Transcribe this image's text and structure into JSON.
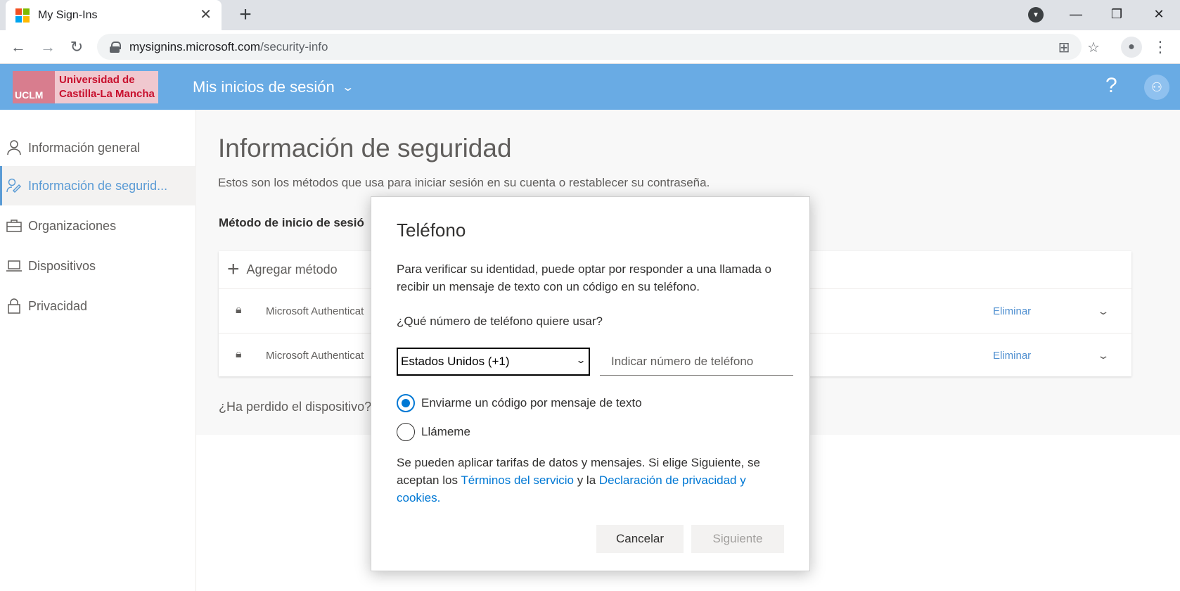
{
  "browser": {
    "tab_title": "My Sign-Ins",
    "url_host": "mysignins.microsoft.com",
    "url_path": "/security-info"
  },
  "header": {
    "org_badge": "UCLM",
    "org_name_line1": "Universidad de",
    "org_name_line2": "Castilla-La Mancha",
    "app_title": "Mis inicios de sesión",
    "help_label": "?"
  },
  "sidebar": {
    "items": [
      {
        "label": "Información general",
        "icon": "person-icon"
      },
      {
        "label": "Información de segurid...",
        "icon": "security-info-icon"
      },
      {
        "label": "Organizaciones",
        "icon": "briefcase-icon"
      },
      {
        "label": "Dispositivos",
        "icon": "laptop-icon"
      },
      {
        "label": "Privacidad",
        "icon": "lock-icon"
      }
    ]
  },
  "main": {
    "title": "Información de seguridad",
    "subtitle": "Estos son los métodos que usa para iniciar sesión en su cuenta o restablecer su contraseña.",
    "method_header": "Método de inicio de sesió",
    "add_method": "Agregar método",
    "methods": [
      {
        "name": "Microsoft Authenticat",
        "action": "Eliminar"
      },
      {
        "name": "Microsoft Authenticat",
        "action": "Eliminar"
      }
    ],
    "lost_device": "¿Ha perdido el dispositivo?"
  },
  "dialog": {
    "title": "Teléfono",
    "description": "Para verificar su identidad, puede optar por responder a una llamada o recibir un mensaje de texto con un código en su teléfono.",
    "question": "¿Qué número de teléfono quiere usar?",
    "country_value": "Estados Unidos (+1)",
    "phone_placeholder": "Indicar número de teléfono",
    "option_text": "Enviarme un código por mensaje de texto",
    "option_call": "Llámeme",
    "selected_option": "text",
    "terms_prefix": "Se pueden aplicar tarifas de datos y mensajes. Si elige Siguiente, se aceptan los ",
    "terms_link": "Términos del servicio",
    "terms_middle": " y la ",
    "privacy_link": "Declaración de privacidad y cookies.",
    "cancel": "Cancelar",
    "next": "Siguiente"
  },
  "colors": {
    "header_bg": "#69abe4",
    "accent": "#0078d4",
    "active_nav": "#5a9bd5"
  }
}
